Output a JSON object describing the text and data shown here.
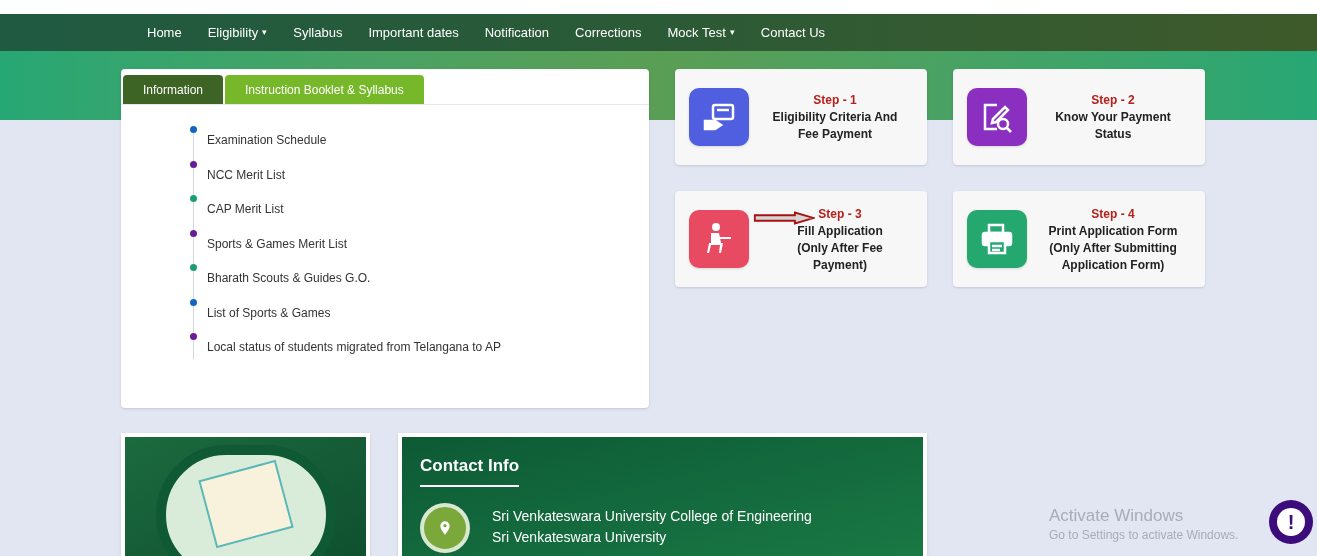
{
  "nav": {
    "items": [
      {
        "label": "Home",
        "dropdown": false
      },
      {
        "label": "Eligibility",
        "dropdown": true
      },
      {
        "label": "Syllabus",
        "dropdown": false
      },
      {
        "label": "Important dates",
        "dropdown": false
      },
      {
        "label": "Notification",
        "dropdown": false
      },
      {
        "label": "Corrections",
        "dropdown": false
      },
      {
        "label": "Mock Test",
        "dropdown": true
      },
      {
        "label": "Contact Us",
        "dropdown": false
      }
    ],
    "caret": "▾"
  },
  "info_panel": {
    "tabs": [
      {
        "label": "Information",
        "selected": true
      },
      {
        "label": "Instruction Booklet & Syllabus",
        "selected": false
      }
    ],
    "items": [
      {
        "label": "Examination Schedule",
        "color": "#1565c0"
      },
      {
        "label": "NCC Merit List",
        "color": "#6a1b9a"
      },
      {
        "label": "CAP Merit List",
        "color": "#1e9e6f"
      },
      {
        "label": "Sports & Games Merit List",
        "color": "#6a1b9a"
      },
      {
        "label": "Bharath Scouts & Guides G.O.",
        "color": "#1e9e6f"
      },
      {
        "label": "List of Sports & Games",
        "color": "#1565c0"
      },
      {
        "label": "Local status of students migrated from Telangana to AP",
        "color": "#6a1b9a"
      }
    ]
  },
  "steps": [
    {
      "kind": "card",
      "step": "Step - 1",
      "title": "Eligibility Criteria And Fee Payment",
      "color": "#4f5fe0",
      "pointer": false
    },
    {
      "kind": "edit",
      "step": "Step - 2",
      "title": "Know Your Payment Status",
      "color": "#8a2fc0",
      "pointer": false
    },
    {
      "kind": "student",
      "step": "Step - 3",
      "title": "Fill Application (Only After Fee Payment)",
      "color": "#e84a62",
      "pointer": true
    },
    {
      "kind": "printer",
      "step": "Step - 4",
      "title": "Print Application Form (Only After Submitting Application Form)",
      "color": "#24a870",
      "pointer": false
    }
  ],
  "contact": {
    "title": "Contact Info",
    "address": [
      "Sri Venkateswara University College of Engineering",
      "Sri Venkateswara University"
    ]
  },
  "help_button": "!",
  "os_notice": {
    "title": "Activate Windows",
    "subtitle": "Go to Settings to activate Windows."
  }
}
